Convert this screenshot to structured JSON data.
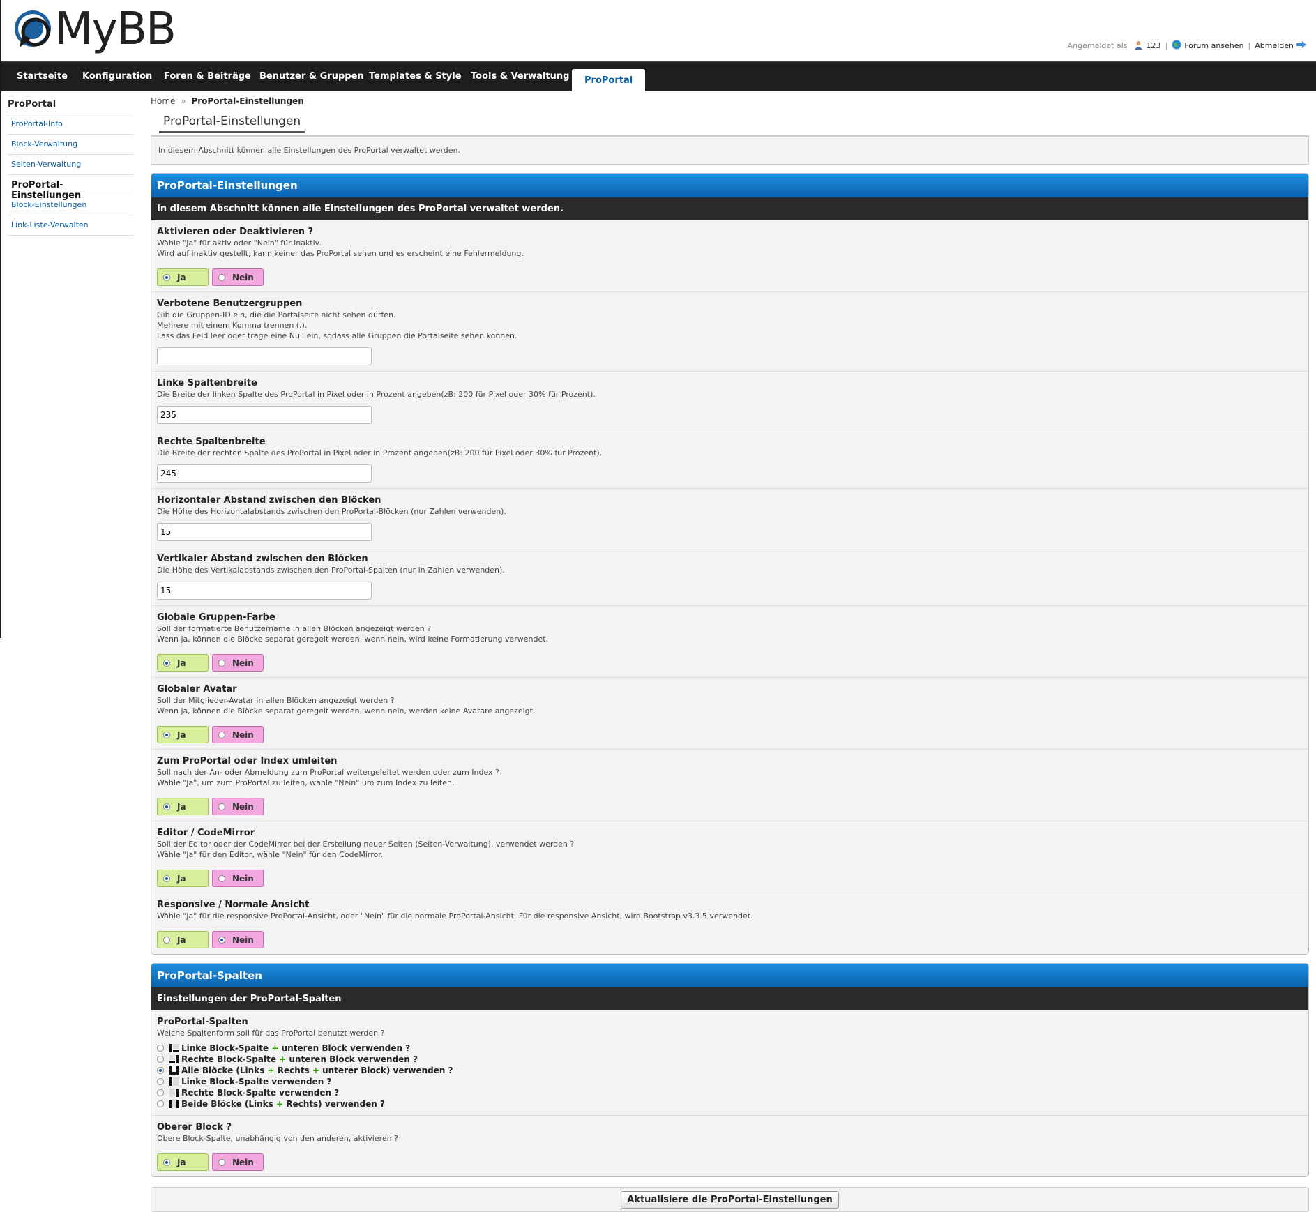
{
  "header": {
    "logo_text": "MyBB",
    "logged_in_label": "Angemeldet als",
    "username": "123",
    "view_forum": "Forum ansehen",
    "logout": "Abmelden"
  },
  "nav": {
    "tabs": [
      "Startseite",
      "Konfiguration",
      "Foren & Beiträge",
      "Benutzer & Gruppen",
      "Templates & Style",
      "Tools & Verwaltung",
      "ProPortal"
    ]
  },
  "sidebar": {
    "title": "ProPortal",
    "items": [
      "ProPortal-Info",
      "Block-Verwaltung",
      "Seiten-Verwaltung",
      "ProPortal-Einstellungen",
      "Block-Einstellungen",
      "Link-Liste-Verwalten"
    ]
  },
  "breadcrumb": {
    "home": "Home",
    "sep": "»",
    "current": "ProPortal-Einstellungen"
  },
  "page_title": "ProPortal-Einstellungen",
  "intro": "In diesem Abschnitt können alle Einstellungen des ProPortal verwaltet werden.",
  "yes_label": "Ja",
  "no_label": "Nein",
  "panel1": {
    "title": "ProPortal-Einstellungen",
    "subtitle": "In diesem Abschnitt können alle Einstellungen des ProPortal verwaltet werden.",
    "settings": [
      {
        "label": "Aktivieren oder Deaktivieren ?",
        "desc1": "Wähle \"Ja\" für aktiv oder \"Nein\" für inaktiv.",
        "desc2": "Wird auf inaktiv gestellt, kann keiner das ProPortal sehen und es erscheint eine Fehlermeldung.",
        "value": "Ja"
      },
      {
        "label": "Verbotene Benutzergruppen",
        "desc1": "Gib die Gruppen-ID ein, die die Portalseite nicht sehen dürfen.",
        "desc2": "Mehrere mit einem Komma trennen (,).",
        "desc3": "Lass das Feld leer oder trage eine Null ein, sodass alle Gruppen die Portalseite sehen können.",
        "value": ""
      },
      {
        "label": "Linke Spaltenbreite",
        "desc1": "Die Breite der linken Spalte des ProPortal in Pixel oder in Prozent angeben(zB: 200 für Pixel oder 30% für Prozent).",
        "value": "235"
      },
      {
        "label": "Rechte Spaltenbreite",
        "desc1": "Die Breite der rechten Spalte des ProPortal in Pixel oder in Prozent angeben(zB: 200 für Pixel oder 30% für Prozent).",
        "value": "245"
      },
      {
        "label": "Horizontaler Abstand zwischen den Blöcken",
        "desc1": "Die Höhe des Horizontalabstands zwischen den ProPortal-Blöcken (nur Zahlen verwenden).",
        "value": "15"
      },
      {
        "label": "Vertikaler Abstand zwischen den Blöcken",
        "desc1": "Die Höhe des Vertikalabstands zwischen den ProPortal-Spalten (nur in Zahlen verwenden).",
        "value": "15"
      },
      {
        "label": "Globale Gruppen-Farbe",
        "desc1": "Soll der formatierte Benutzername in allen Blöcken angezeigt werden ?",
        "desc2": "Wenn ja, können die Blöcke separat geregelt werden, wenn nein, wird keine Formatierung verwendet.",
        "value": "Ja"
      },
      {
        "label": "Globaler Avatar",
        "desc1": "Soll der Mitglieder-Avatar in allen Blöcken angezeigt werden ?",
        "desc2": "Wenn ja, können die Blöcke separat geregelt werden, wenn nein, werden keine Avatare angezeigt.",
        "value": "Ja"
      },
      {
        "label": "Zum ProPortal oder Index umleiten",
        "desc1": "Soll nach der An- oder Abmeldung zum ProPortal weitergeleitet werden oder zum Index ?",
        "desc2": "Wähle \"Ja\", um zum ProPortal zu leiten, wähle \"Nein\" um zum Index zu leiten.",
        "value": "Ja"
      },
      {
        "label": "Editor / CodeMirror",
        "desc1": "Soll der Editor oder der CodeMirror bei der Erstellung neuer Seiten (Seiten-Verwaltung), verwendet werden ?",
        "desc2": "Wähle \"Ja\" für den Editor, wähle \"Nein\" für den CodeMirror.",
        "value": "Ja"
      },
      {
        "label": "Responsive / Normale Ansicht",
        "desc1": "Wähle \"Ja\" für die responsive ProPortal-Ansicht, oder \"Nein\" für die normale ProPortal-Ansicht. Für die responsive Ansicht, wird Bootstrap v3.3.5 verwendet.",
        "value": "Nein"
      }
    ]
  },
  "panel2": {
    "title": "ProPortal-Spalten",
    "subtitle": "Einstellungen der ProPortal-Spalten",
    "columns_label": "ProPortal-Spalten",
    "columns_desc": "Welche Spaltenform soll für das ProPortal benutzt werden ?",
    "column_options": [
      {
        "a": "Linke Block-Spalte",
        "b": "unteren Block verwenden ?",
        "selected": false
      },
      {
        "a": "Rechte Block-Spalte",
        "b": "unteren Block verwenden ?",
        "selected": false
      },
      {
        "a": "Alle Blöcke (Links",
        "b": "Rechts",
        "c": "unterer Block) verwenden ?",
        "selected": true
      },
      {
        "a": "Linke Block-Spalte verwenden ?",
        "selected": false
      },
      {
        "a": "Rechte Block-Spalte verwenden ?",
        "selected": false
      },
      {
        "a": "Beide Blöcke (Links",
        "b": "Rechts) verwenden ?",
        "selected": false
      }
    ],
    "top_label": "Oberer Block ?",
    "top_desc": "Obere Block-Spalte, unabhängig von den anderen, aktivieren ?",
    "top_value": "Ja"
  },
  "submit_label": "Aktualisiere die ProPortal-Einstellungen"
}
